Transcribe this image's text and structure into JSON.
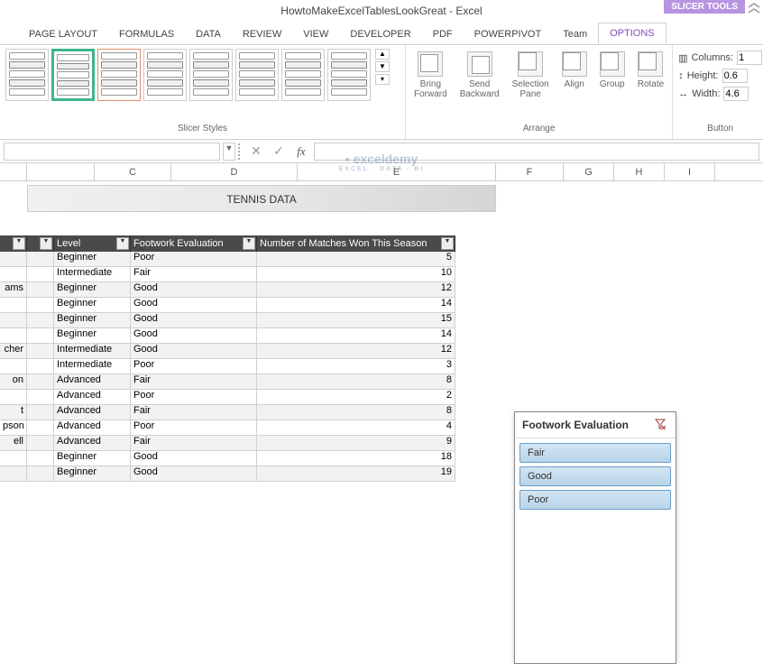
{
  "title": "HowtoMakeExcelTablesLookGreat - Excel",
  "slicer_tools_label": "SLICER TOOLS",
  "tabs": [
    "PAGE LAYOUT",
    "FORMULAS",
    "DATA",
    "REVIEW",
    "VIEW",
    "DEVELOPER",
    "PDF",
    "POWERPIVOT",
    "Team",
    "OPTIONS"
  ],
  "active_tab": 9,
  "ribbon": {
    "slicer_styles_label": "Slicer Styles",
    "arrange": {
      "label": "Arrange",
      "bring_forward": "Bring\nForward",
      "send_backward": "Send\nBackward",
      "selection_pane": "Selection\nPane",
      "align": "Align",
      "group": "Group",
      "rotate": "Rotate"
    },
    "buttons": {
      "label": "Button",
      "columns_label": "Columns:",
      "columns_value": "1",
      "height_label": "Height:",
      "height_value": "0.6",
      "width_label": "Width:",
      "width_value": "4.6"
    }
  },
  "columns": [
    "",
    "",
    "C",
    "D",
    "E",
    "F",
    "G",
    "H",
    "I"
  ],
  "banner": "TENNIS DATA",
  "table": {
    "headers": [
      "",
      "Level",
      "Footwork Evaluation",
      "Number of Matches Won This Season"
    ],
    "rows": [
      {
        "a": "",
        "level": "Beginner",
        "fe": "Poor",
        "n": "5"
      },
      {
        "a": "",
        "level": "Intermediate",
        "fe": "Fair",
        "n": "10"
      },
      {
        "a": "ams",
        "level": "Beginner",
        "fe": "Good",
        "n": "12"
      },
      {
        "a": "",
        "level": "Beginner",
        "fe": "Good",
        "n": "14"
      },
      {
        "a": "",
        "level": "Beginner",
        "fe": "Good",
        "n": "15"
      },
      {
        "a": "",
        "level": "Beginner",
        "fe": "Good",
        "n": "14"
      },
      {
        "a": "cher",
        "level": "Intermediate",
        "fe": "Good",
        "n": "12"
      },
      {
        "a": "",
        "level": "Intermediate",
        "fe": "Poor",
        "n": "3"
      },
      {
        "a": "on",
        "level": "Advanced",
        "fe": "Fair",
        "n": "8"
      },
      {
        "a": "",
        "level": "Advanced",
        "fe": "Poor",
        "n": "2"
      },
      {
        "a": "t",
        "level": "Advanced",
        "fe": "Fair",
        "n": "8"
      },
      {
        "a": "pson",
        "level": "Advanced",
        "fe": "Poor",
        "n": "4"
      },
      {
        "a": "ell",
        "level": "Advanced",
        "fe": "Fair",
        "n": "9"
      },
      {
        "a": "",
        "level": "Beginner",
        "fe": "Good",
        "n": "18"
      },
      {
        "a": "",
        "level": "Beginner",
        "fe": "Good",
        "n": "19"
      }
    ]
  },
  "slicer": {
    "title": "Footwork Evaluation",
    "items": [
      "Fair",
      "Good",
      "Poor"
    ]
  },
  "watermark": {
    "main": "exceldemy",
    "sub": "EXCEL · DATA · BI"
  }
}
